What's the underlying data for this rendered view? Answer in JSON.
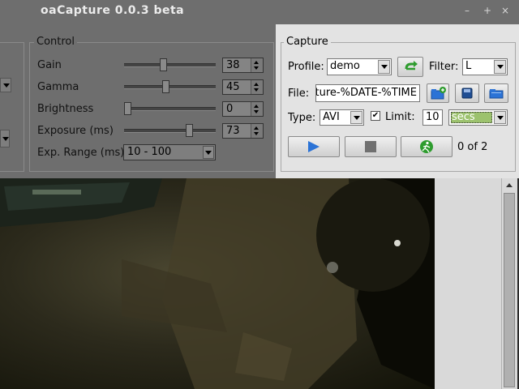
{
  "window": {
    "title": "oaCapture 0.0.3 beta",
    "controls": [
      "–",
      "+",
      "×"
    ]
  },
  "control": {
    "title": "Control",
    "rows": [
      {
        "label": "Gain",
        "value": "38",
        "slider_fraction": 0.42
      },
      {
        "label": "Gamma",
        "value": "45",
        "slider_fraction": 0.45
      },
      {
        "label": "Brightness",
        "value": "0",
        "slider_fraction": 0.0
      },
      {
        "label": "Exposure (ms)",
        "value": "73",
        "slider_fraction": 0.73
      }
    ],
    "exp_range": {
      "label": "Exp. Range (ms)",
      "value": "10 - 100"
    }
  },
  "capture": {
    "title": "Capture",
    "profile": {
      "label": "Profile:",
      "value": "demo"
    },
    "filter": {
      "label": "Filter:",
      "value": "L"
    },
    "file": {
      "label": "File:",
      "value": "pture-%DATE-%TIME"
    },
    "type": {
      "label": "Type:",
      "value": "AVI"
    },
    "limit": {
      "label": "Limit:",
      "checked": true,
      "value": "10",
      "unit": "secs"
    },
    "progress": "0 of 2"
  },
  "colors": {
    "panel_dark": "#6e6e6e",
    "panel_light": "#e3e3e3",
    "accent_blue": "#2b73d6",
    "accent_green": "#2e9c2e"
  }
}
